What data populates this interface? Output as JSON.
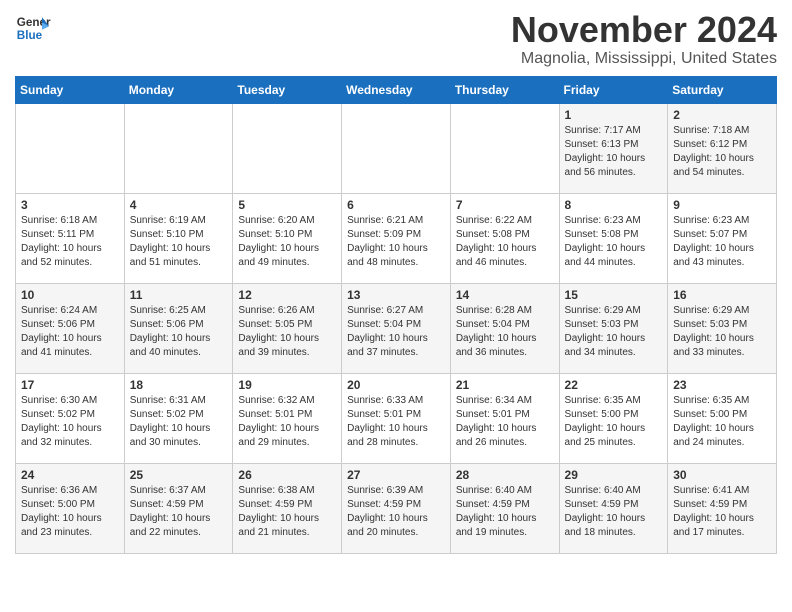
{
  "logo": {
    "line1": "General",
    "line2": "Blue"
  },
  "title": "November 2024",
  "location": "Magnolia, Mississippi, United States",
  "weekdays": [
    "Sunday",
    "Monday",
    "Tuesday",
    "Wednesday",
    "Thursday",
    "Friday",
    "Saturday"
  ],
  "weeks": [
    [
      {
        "day": "",
        "info": ""
      },
      {
        "day": "",
        "info": ""
      },
      {
        "day": "",
        "info": ""
      },
      {
        "day": "",
        "info": ""
      },
      {
        "day": "",
        "info": ""
      },
      {
        "day": "1",
        "info": "Sunrise: 7:17 AM\nSunset: 6:13 PM\nDaylight: 10 hours\nand 56 minutes."
      },
      {
        "day": "2",
        "info": "Sunrise: 7:18 AM\nSunset: 6:12 PM\nDaylight: 10 hours\nand 54 minutes."
      }
    ],
    [
      {
        "day": "3",
        "info": "Sunrise: 6:18 AM\nSunset: 5:11 PM\nDaylight: 10 hours\nand 52 minutes."
      },
      {
        "day": "4",
        "info": "Sunrise: 6:19 AM\nSunset: 5:10 PM\nDaylight: 10 hours\nand 51 minutes."
      },
      {
        "day": "5",
        "info": "Sunrise: 6:20 AM\nSunset: 5:10 PM\nDaylight: 10 hours\nand 49 minutes."
      },
      {
        "day": "6",
        "info": "Sunrise: 6:21 AM\nSunset: 5:09 PM\nDaylight: 10 hours\nand 48 minutes."
      },
      {
        "day": "7",
        "info": "Sunrise: 6:22 AM\nSunset: 5:08 PM\nDaylight: 10 hours\nand 46 minutes."
      },
      {
        "day": "8",
        "info": "Sunrise: 6:23 AM\nSunset: 5:08 PM\nDaylight: 10 hours\nand 44 minutes."
      },
      {
        "day": "9",
        "info": "Sunrise: 6:23 AM\nSunset: 5:07 PM\nDaylight: 10 hours\nand 43 minutes."
      }
    ],
    [
      {
        "day": "10",
        "info": "Sunrise: 6:24 AM\nSunset: 5:06 PM\nDaylight: 10 hours\nand 41 minutes."
      },
      {
        "day": "11",
        "info": "Sunrise: 6:25 AM\nSunset: 5:06 PM\nDaylight: 10 hours\nand 40 minutes."
      },
      {
        "day": "12",
        "info": "Sunrise: 6:26 AM\nSunset: 5:05 PM\nDaylight: 10 hours\nand 39 minutes."
      },
      {
        "day": "13",
        "info": "Sunrise: 6:27 AM\nSunset: 5:04 PM\nDaylight: 10 hours\nand 37 minutes."
      },
      {
        "day": "14",
        "info": "Sunrise: 6:28 AM\nSunset: 5:04 PM\nDaylight: 10 hours\nand 36 minutes."
      },
      {
        "day": "15",
        "info": "Sunrise: 6:29 AM\nSunset: 5:03 PM\nDaylight: 10 hours\nand 34 minutes."
      },
      {
        "day": "16",
        "info": "Sunrise: 6:29 AM\nSunset: 5:03 PM\nDaylight: 10 hours\nand 33 minutes."
      }
    ],
    [
      {
        "day": "17",
        "info": "Sunrise: 6:30 AM\nSunset: 5:02 PM\nDaylight: 10 hours\nand 32 minutes."
      },
      {
        "day": "18",
        "info": "Sunrise: 6:31 AM\nSunset: 5:02 PM\nDaylight: 10 hours\nand 30 minutes."
      },
      {
        "day": "19",
        "info": "Sunrise: 6:32 AM\nSunset: 5:01 PM\nDaylight: 10 hours\nand 29 minutes."
      },
      {
        "day": "20",
        "info": "Sunrise: 6:33 AM\nSunset: 5:01 PM\nDaylight: 10 hours\nand 28 minutes."
      },
      {
        "day": "21",
        "info": "Sunrise: 6:34 AM\nSunset: 5:01 PM\nDaylight: 10 hours\nand 26 minutes."
      },
      {
        "day": "22",
        "info": "Sunrise: 6:35 AM\nSunset: 5:00 PM\nDaylight: 10 hours\nand 25 minutes."
      },
      {
        "day": "23",
        "info": "Sunrise: 6:35 AM\nSunset: 5:00 PM\nDaylight: 10 hours\nand 24 minutes."
      }
    ],
    [
      {
        "day": "24",
        "info": "Sunrise: 6:36 AM\nSunset: 5:00 PM\nDaylight: 10 hours\nand 23 minutes."
      },
      {
        "day": "25",
        "info": "Sunrise: 6:37 AM\nSunset: 4:59 PM\nDaylight: 10 hours\nand 22 minutes."
      },
      {
        "day": "26",
        "info": "Sunrise: 6:38 AM\nSunset: 4:59 PM\nDaylight: 10 hours\nand 21 minutes."
      },
      {
        "day": "27",
        "info": "Sunrise: 6:39 AM\nSunset: 4:59 PM\nDaylight: 10 hours\nand 20 minutes."
      },
      {
        "day": "28",
        "info": "Sunrise: 6:40 AM\nSunset: 4:59 PM\nDaylight: 10 hours\nand 19 minutes."
      },
      {
        "day": "29",
        "info": "Sunrise: 6:40 AM\nSunset: 4:59 PM\nDaylight: 10 hours\nand 18 minutes."
      },
      {
        "day": "30",
        "info": "Sunrise: 6:41 AM\nSunset: 4:59 PM\nDaylight: 10 hours\nand 17 minutes."
      }
    ]
  ]
}
